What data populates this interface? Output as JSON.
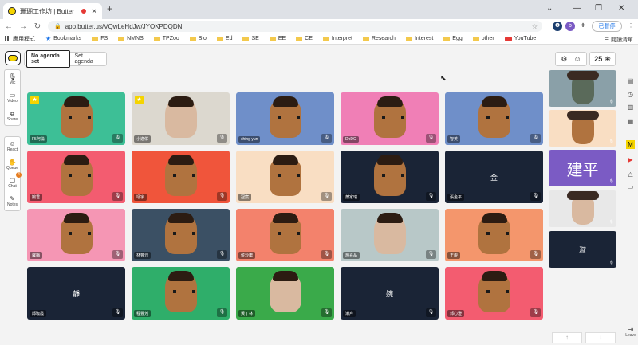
{
  "browser": {
    "tab_title": "珊瑚工作坊 | Butter",
    "url": "app.butter.us/VQwLeHdJw/JYOKPDQDN",
    "profile_label": "已暫停",
    "bookmarks": [
      {
        "label": "應用程式",
        "icon": "apps-icon"
      },
      {
        "label": "Bookmarks",
        "icon": "star-icon"
      },
      {
        "label": "FS",
        "icon": "folder-icon"
      },
      {
        "label": "NMNS",
        "icon": "folder-icon"
      },
      {
        "label": "TPZoo",
        "icon": "folder-icon"
      },
      {
        "label": "Bio",
        "icon": "folder-icon"
      },
      {
        "label": "Ed",
        "icon": "folder-icon"
      },
      {
        "label": "SE",
        "icon": "folder-icon"
      },
      {
        "label": "EE",
        "icon": "folder-icon"
      },
      {
        "label": "CE",
        "icon": "folder-icon"
      },
      {
        "label": "Interpret",
        "icon": "folder-icon"
      },
      {
        "label": "Research",
        "icon": "folder-icon"
      },
      {
        "label": "Interest",
        "icon": "folder-icon"
      },
      {
        "label": "Egg",
        "icon": "folder-icon"
      },
      {
        "label": "other",
        "icon": "folder-icon"
      },
      {
        "label": "YouTube",
        "icon": "youtube-icon"
      }
    ],
    "reading_list": "閱讀清單"
  },
  "app": {
    "agenda": {
      "tab_active": "No agenda set",
      "tab_set": "Set agenda"
    },
    "participants_count": "25",
    "left_tools": [
      {
        "label": "Mic",
        "icon": "mic-icon"
      },
      {
        "label": "Video",
        "icon": "video-icon"
      },
      {
        "label": "Share",
        "icon": "share-screen-icon"
      },
      {
        "label": "React",
        "icon": "react-icon"
      },
      {
        "label": "Queue",
        "icon": "queue-icon"
      },
      {
        "label": "Chat",
        "icon": "chat-icon",
        "badge": "4"
      },
      {
        "label": "Notes",
        "icon": "notes-icon"
      }
    ],
    "leave_label": "Leave",
    "tiles": [
      {
        "name": "F5阿倫",
        "bg": "#3dbf96",
        "kind": "avatar",
        "star": true
      },
      {
        "name": "小逸佑",
        "bg": "#dcd8cf",
        "kind": "camera",
        "star": true
      },
      {
        "name": "ching yun",
        "bg": "#6f8fc9",
        "kind": "avatar"
      },
      {
        "name": "DoDO",
        "bg": "#f07fb6",
        "kind": "avatar"
      },
      {
        "name": "智英",
        "bg": "#6f8fc9",
        "kind": "avatar"
      },
      {
        "name": "婉君",
        "bg": "#f35c70",
        "kind": "avatar"
      },
      {
        "name": "翊宇",
        "bg": "#f0553b",
        "kind": "avatar"
      },
      {
        "name": "冠宸",
        "bg": "#f9dec3",
        "kind": "avatar"
      },
      {
        "name": "蕭家瑞",
        "bg": "#1a2436",
        "kind": "avatar"
      },
      {
        "name": "張金平",
        "bg": "#1a2436",
        "kind": "text",
        "text": "金"
      },
      {
        "name": "馨梅",
        "bg": "#f596b4",
        "kind": "avatar"
      },
      {
        "name": "林豐元",
        "bg": "#3b5064",
        "kind": "avatar"
      },
      {
        "name": "侯沙庸",
        "bg": "#f3826c",
        "kind": "avatar"
      },
      {
        "name": "詹喜晶",
        "bg": "#b8c8c8",
        "kind": "camera"
      },
      {
        "name": "王虔",
        "bg": "#f4966c",
        "kind": "avatar"
      },
      {
        "name": "邱琡霞",
        "bg": "#1a2436",
        "kind": "text",
        "text": "靜"
      },
      {
        "name": "程豐芳",
        "bg": "#2fae6a",
        "kind": "avatar"
      },
      {
        "name": "黃丁林",
        "bg": "#3aaa4a",
        "kind": "camera"
      },
      {
        "name": "瀨戶",
        "bg": "#1a2436",
        "kind": "text",
        "text": "婉"
      },
      {
        "name": "郭心澄",
        "bg": "#f35c70",
        "kind": "avatar"
      }
    ],
    "side_tiles": [
      {
        "bg": "#8aa0a8",
        "kind": "photo"
      },
      {
        "bg": "#f9dec3",
        "kind": "avatar"
      },
      {
        "bg": "#7b5bc4",
        "kind": "text",
        "text": "建平"
      },
      {
        "bg": "#e8e8e8",
        "kind": "camera"
      },
      {
        "bg": "#1a2436",
        "kind": "text",
        "text": "淑"
      }
    ]
  }
}
